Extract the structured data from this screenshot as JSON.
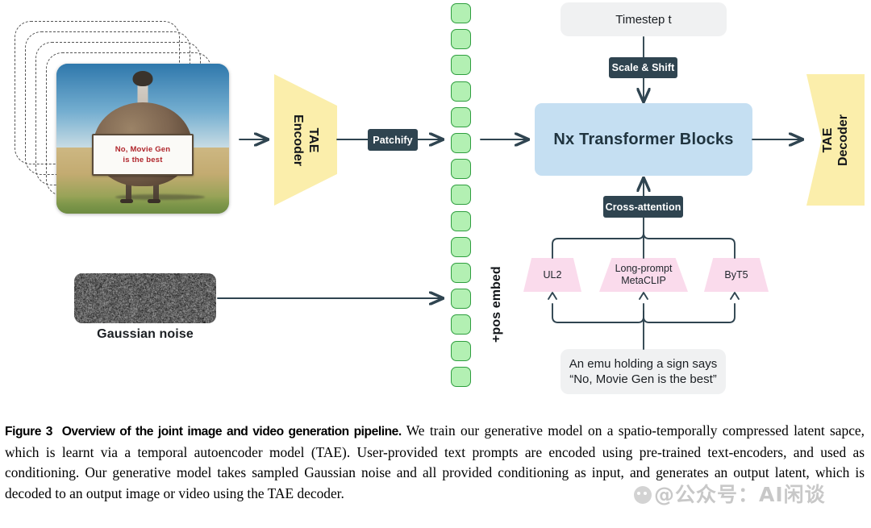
{
  "figure": {
    "title": "Overview of the joint image and video generation pipeline.",
    "nodes": {
      "tae_encoder": "TAE\nEncoder",
      "tae_encoder_line1": "TAE",
      "tae_encoder_line2": "Encoder",
      "tae_decoder_line1": "TAE",
      "tae_decoder_line2": "Decoder",
      "patchify": "Patchify",
      "pos_embed": "+pos embed",
      "timestep": "Timestep t",
      "scale_shift": "Scale & Shift",
      "transformer": "Nx Transformer Blocks",
      "cross_attention": "Cross-attention",
      "gaussian_noise": "Gaussian noise",
      "prompt_line1": "An emu holding a sign says",
      "prompt_line2": "“No, Movie Gen is the best”"
    },
    "text_encoders": [
      {
        "name": "UL2",
        "line1": "UL2",
        "line2": ""
      },
      {
        "name": "Long-prompt MetaCLIP",
        "line1": "Long-prompt",
        "line2": "MetaCLIP"
      },
      {
        "name": "ByT5",
        "line1": "ByT5",
        "line2": ""
      }
    ],
    "input_image": {
      "sign_line1": "No, Movie Gen",
      "sign_line2": "is the best",
      "stack_frames": 4
    },
    "latent_tokens": {
      "count": 15,
      "color": "#b3f0b3",
      "border_color": "#2f9e3f"
    },
    "colors": {
      "tae_yellow": "#fbeeab",
      "transformer_blue": "#c5dff2",
      "encoder_pink": "#fadbec",
      "dark_box": "#2f4450",
      "grey_box": "#f0f1f2",
      "wire": "#2f4450",
      "token_green": "#b3f0b3"
    }
  },
  "caption": {
    "label": "Figure 3",
    "bold_title": "Overview of the joint image and video generation pipeline.",
    "body": " We train our generative model on a spatio-temporally compressed latent sapce, which is learnt via a temporal autoencoder model (TAE). User-provided text prompts are encoded using pre-trained text-encoders, and used as conditioning. Our generative model takes sampled Gaussian noise and all provided conditioning as input, and generates an output latent, which is decoded to an output image or video using the TAE decoder."
  },
  "watermark": {
    "text": "公众号：AI闲谈",
    "prefix": "@"
  }
}
